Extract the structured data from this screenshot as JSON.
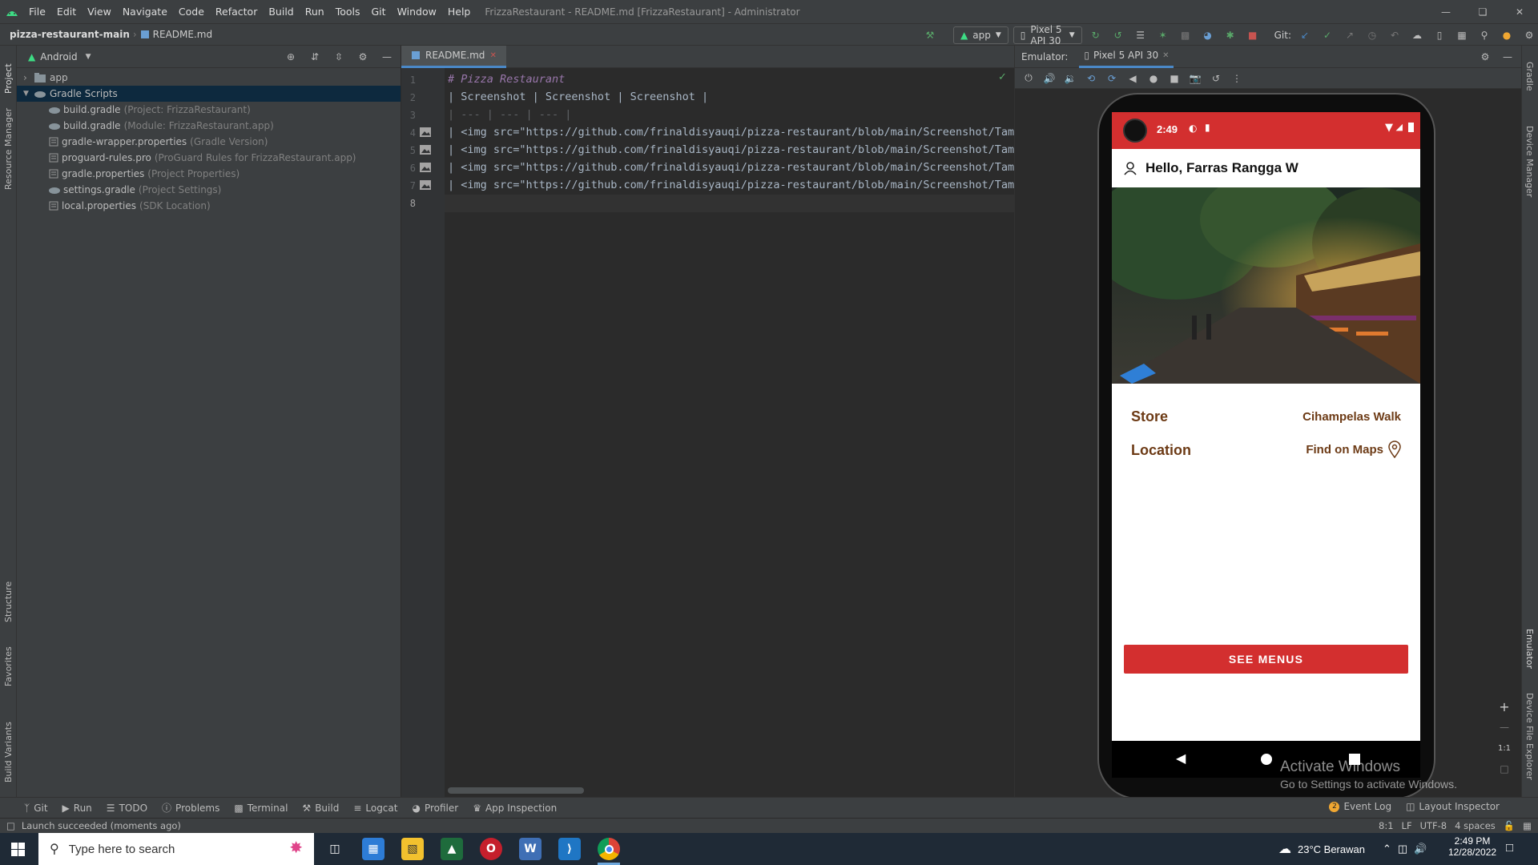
{
  "titlebar": {
    "menus": [
      "File",
      "Edit",
      "View",
      "Navigate",
      "Code",
      "Refactor",
      "Build",
      "Run",
      "Tools",
      "Git",
      "Window",
      "Help"
    ],
    "window_title": "FrizzaRestaurant - README.md [FrizzaRestaurant] - Administrator"
  },
  "navbar": {
    "breadcrumb_project": "pizza-restaurant-main",
    "breadcrumb_file": "README.md",
    "run_config": "app",
    "device": "Pixel 5 API 30",
    "git_label": "Git:"
  },
  "leftstripe": {
    "project": "Project",
    "resource_manager": "Resource Manager",
    "structure": "Structure",
    "favorites": "Favorites",
    "build_variants": "Build Variants"
  },
  "rightstripe": {
    "gradle": "Gradle",
    "device_manager": "Device Manager",
    "emulator": "Emulator",
    "device_file_explorer": "Device File Explorer"
  },
  "project": {
    "view_mode": "Android",
    "items": [
      {
        "name": "app",
        "hint": ""
      },
      {
        "name": "Gradle Scripts",
        "hint": ""
      },
      {
        "name": "build.gradle",
        "hint": "(Project: FrizzaRestaurant)"
      },
      {
        "name": "build.gradle",
        "hint": "(Module: FrizzaRestaurant.app)"
      },
      {
        "name": "gradle-wrapper.properties",
        "hint": "(Gradle Version)"
      },
      {
        "name": "proguard-rules.pro",
        "hint": "(ProGuard Rules for FrizzaRestaurant.app)"
      },
      {
        "name": "gradle.properties",
        "hint": "(Project Properties)"
      },
      {
        "name": "settings.gradle",
        "hint": "(Project Settings)"
      },
      {
        "name": "local.properties",
        "hint": "(SDK Location)"
      }
    ]
  },
  "editor": {
    "tab": "README.md",
    "lines": [
      {
        "n": "1",
        "text": "# Pizza Restaurant"
      },
      {
        "n": "2",
        "text": "| Screenshot | Screenshot | Screenshot |"
      },
      {
        "n": "3",
        "text": "| --- | --- | --- |"
      },
      {
        "n": "4",
        "text": "| <img src=\"https://github.com/frinaldisyauqi/pizza-restaurant/blob/main/Screenshot/Tamp:"
      },
      {
        "n": "5",
        "text": "| <img src=\"https://github.com/frinaldisyauqi/pizza-restaurant/blob/main/Screenshot/Tamp:"
      },
      {
        "n": "6",
        "text": "| <img src=\"https://github.com/frinaldisyauqi/pizza-restaurant/blob/main/Screenshot/Tamp:"
      },
      {
        "n": "7",
        "text": "| <img src=\"https://github.com/frinaldisyauqi/pizza-restaurant/blob/main/Screenshot/Tamp:"
      },
      {
        "n": "8",
        "text": ""
      }
    ]
  },
  "emulator": {
    "label": "Emulator:",
    "tab": "Pixel 5 API 30",
    "zoom_reset": "1:1"
  },
  "phone": {
    "time": "2:49",
    "greeting": "Hello, Farras Rangga W",
    "store_label": "Store",
    "store_value": "Cihampelas Walk",
    "location_label": "Location",
    "location_value": "Find on Maps",
    "button": "SEE MENUS"
  },
  "watermark": {
    "title": "Activate Windows",
    "subtitle": "Go to Settings to activate Windows."
  },
  "bottomtools": {
    "left": [
      "Git",
      "Run",
      "TODO",
      "Problems",
      "Terminal",
      "Build",
      "Logcat",
      "Profiler",
      "App Inspection"
    ],
    "right": [
      "Event Log",
      "Layout Inspector"
    ]
  },
  "statusline": {
    "message": "Launch succeeded (moments ago)",
    "position": "8:1",
    "line_sep": "LF",
    "encoding": "UTF-8",
    "indent": "4 spaces"
  },
  "taskbar": {
    "search_placeholder": "Type here to search",
    "weather": "23°C  Berawan",
    "time": "2:49 PM",
    "date": "12/28/2022"
  },
  "colors": {
    "accent_red": "#d32f2f",
    "brown_text": "#6d3b16",
    "ide_bg": "#2b2b2b",
    "panel_bg": "#3c3f41"
  }
}
